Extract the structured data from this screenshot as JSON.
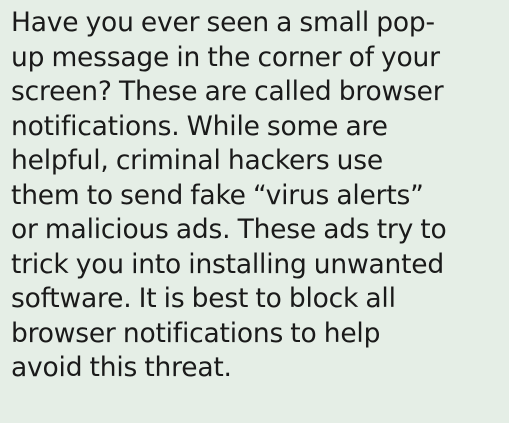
{
  "content": {
    "paragraph_lines": [
      "Have you ever seen a small pop-",
      "up message in the corner of your",
      "screen? These are called browser",
      "notifications. While some are",
      "helpful, criminal hackers use",
      "them to send fake “virus alerts”",
      "or malicious ads. These ads try to",
      "trick you into installing unwanted",
      "software. It is best to block all",
      "browser notifications to help",
      "avoid this threat."
    ]
  },
  "colors": {
    "background": "#e5eee6",
    "text": "#1a1a1a"
  }
}
